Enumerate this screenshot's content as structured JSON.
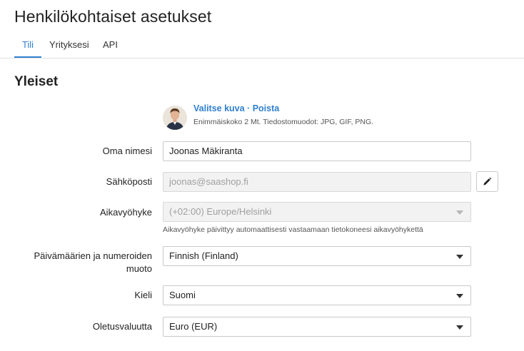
{
  "page": {
    "title": "Henkilökohtaiset asetukset"
  },
  "tabs": [
    {
      "label": "Tili",
      "active": true
    },
    {
      "label": "Yrityksesi",
      "active": false
    },
    {
      "label": "API",
      "active": false
    }
  ],
  "section": {
    "title": "Yleiset"
  },
  "photo": {
    "choose_label": "Valitse kuva",
    "separator": " · ",
    "remove_label": "Poista",
    "hint": "Enimmäiskoko 2 Mt. Tiedostomuodot: JPG, GIF, PNG."
  },
  "form": {
    "name": {
      "label": "Oma nimesi",
      "value": "Joonas Mäkiranta"
    },
    "email": {
      "label": "Sähköposti",
      "value": "joonas@saashop.fi"
    },
    "timezone": {
      "label": "Aikavyöhyke",
      "value": "(+02:00) Europe/Helsinki",
      "help": "Aikavyöhyke päivittyy automaattisesti vastaamaan tietokoneesi aikavyöhykettä"
    },
    "locale": {
      "label": "Päivämäärien ja numeroiden muoto",
      "value": "Finnish (Finland)"
    },
    "language": {
      "label": "Kieli",
      "value": "Suomi"
    },
    "currency": {
      "label": "Oletusvaluutta",
      "value": "Euro (EUR)"
    }
  },
  "colors": {
    "accent": "#2f7fd0",
    "disabled_bg": "#f2f2f2"
  },
  "icons": {
    "edit": "pencil-icon",
    "dropdown": "caret-down-icon"
  }
}
